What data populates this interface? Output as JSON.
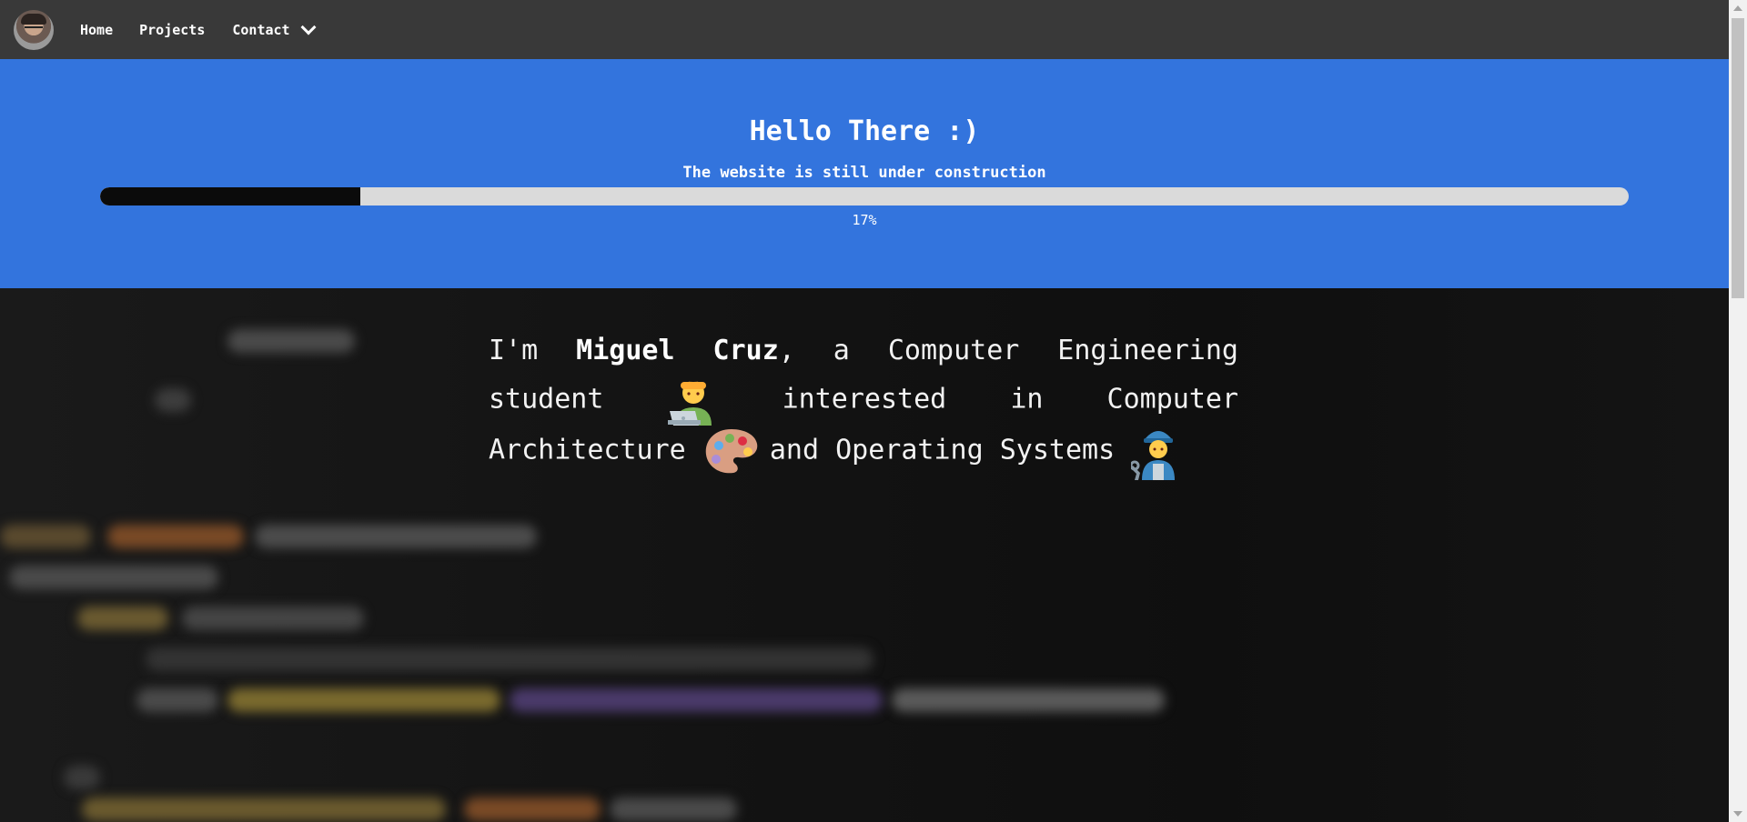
{
  "nav": {
    "home": "Home",
    "projects": "Projects",
    "contact": "Contact"
  },
  "hero": {
    "title": "Hello There :)",
    "subtitle": "The website is still under construction",
    "progress_value": 0.17,
    "progress_text": "17%"
  },
  "intro": {
    "part1": "I'm",
    "name": "Miguel Cruz",
    "part2": ", a Computer Engineering student",
    "part3": "interested in Computer Architecture",
    "part4": "and",
    "part5": "Operating Systems"
  },
  "icons": {
    "avatar": "profile-photo",
    "chevron": "chevron-down-icon",
    "emoji1": "technologist-emoji",
    "emoji2": "artist-palette-emoji",
    "emoji3": "mechanic-emoji"
  },
  "colors": {
    "navbar": "#393939",
    "hero": "#3374dd",
    "progress_fill": "#0b0b0b",
    "progress_track": "#dadada"
  }
}
